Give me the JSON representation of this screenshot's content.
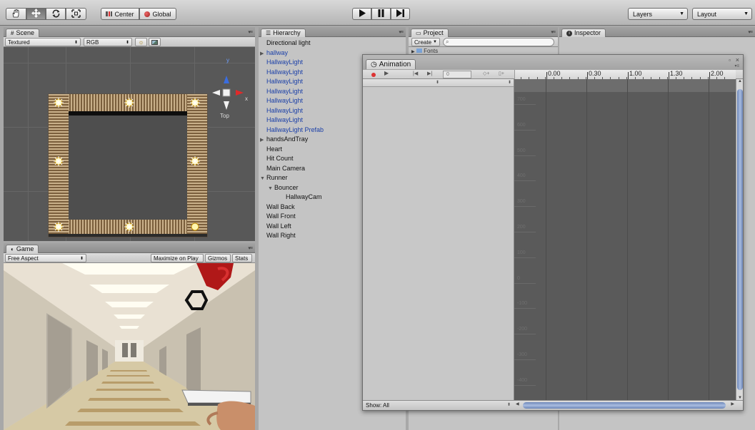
{
  "toolbar": {
    "pivot_label": "Center",
    "space_label": "Global",
    "layers_label": "Layers",
    "layout_label": "Layout"
  },
  "scene": {
    "tab_label": "Scene",
    "draw_mode": "Textured",
    "render_mode": "RGB",
    "gizmo_axis_y": "y",
    "gizmo_axis_x": "x",
    "gizmo_view": "Top"
  },
  "game": {
    "tab_label": "Game",
    "aspect": "Free Aspect",
    "maximize_label": "Maximize on Play",
    "gizmos_label": "Gizmos",
    "stats_label": "Stats"
  },
  "hierarchy": {
    "tab_label": "Hierarchy",
    "items": [
      {
        "label": "Directional light",
        "indent": 0,
        "arrow": "",
        "prefab": false
      },
      {
        "label": "hallway",
        "indent": 0,
        "arrow": "▶",
        "prefab": true
      },
      {
        "label": "HallwayLight",
        "indent": 0,
        "arrow": "",
        "prefab": true
      },
      {
        "label": "HallwayLight",
        "indent": 0,
        "arrow": "",
        "prefab": true
      },
      {
        "label": "HallwayLight",
        "indent": 0,
        "arrow": "",
        "prefab": true
      },
      {
        "label": "HallwayLight",
        "indent": 0,
        "arrow": "",
        "prefab": true
      },
      {
        "label": "HallwayLight",
        "indent": 0,
        "arrow": "",
        "prefab": true
      },
      {
        "label": "HallwayLight",
        "indent": 0,
        "arrow": "",
        "prefab": true
      },
      {
        "label": "HallwayLight",
        "indent": 0,
        "arrow": "",
        "prefab": true
      },
      {
        "label": "HallwayLight Prefab",
        "indent": 0,
        "arrow": "",
        "prefab": true
      },
      {
        "label": "handsAndTray",
        "indent": 0,
        "arrow": "▶",
        "prefab": false
      },
      {
        "label": "Heart",
        "indent": 0,
        "arrow": "",
        "prefab": false
      },
      {
        "label": "Hit Count",
        "indent": 0,
        "arrow": "",
        "prefab": false
      },
      {
        "label": "Main Camera",
        "indent": 0,
        "arrow": "",
        "prefab": false
      },
      {
        "label": "Runner",
        "indent": 0,
        "arrow": "▼",
        "prefab": false
      },
      {
        "label": "Bouncer",
        "indent": 1,
        "arrow": "▼",
        "prefab": false
      },
      {
        "label": "HallwayCam",
        "indent": 2,
        "arrow": "",
        "prefab": false
      },
      {
        "label": "Wall Back",
        "indent": 0,
        "arrow": "",
        "prefab": false
      },
      {
        "label": "Wall Front",
        "indent": 0,
        "arrow": "",
        "prefab": false
      },
      {
        "label": "Wall Left",
        "indent": 0,
        "arrow": "",
        "prefab": false
      },
      {
        "label": "Wall Right",
        "indent": 0,
        "arrow": "",
        "prefab": false
      }
    ]
  },
  "project": {
    "tab_label": "Project",
    "create_label": "Create",
    "folder_label": "Fonts"
  },
  "inspector": {
    "tab_label": "Inspector"
  },
  "animation": {
    "tab_label": "Animation",
    "frame_value": "0",
    "time_labels": [
      "0.00",
      "0.30",
      "1.00",
      "1.30",
      "2.00"
    ],
    "y_labels": [
      "700",
      "600",
      "500",
      "400",
      "300",
      "200",
      "100",
      "0",
      "-100",
      "-200",
      "-300",
      "-400"
    ],
    "show_label": "Show: All"
  },
  "colors": {
    "prefab_text": "#1a3fa8",
    "curve_bg": "#5a5a5a",
    "scrollbar": "#8ea3c8"
  }
}
